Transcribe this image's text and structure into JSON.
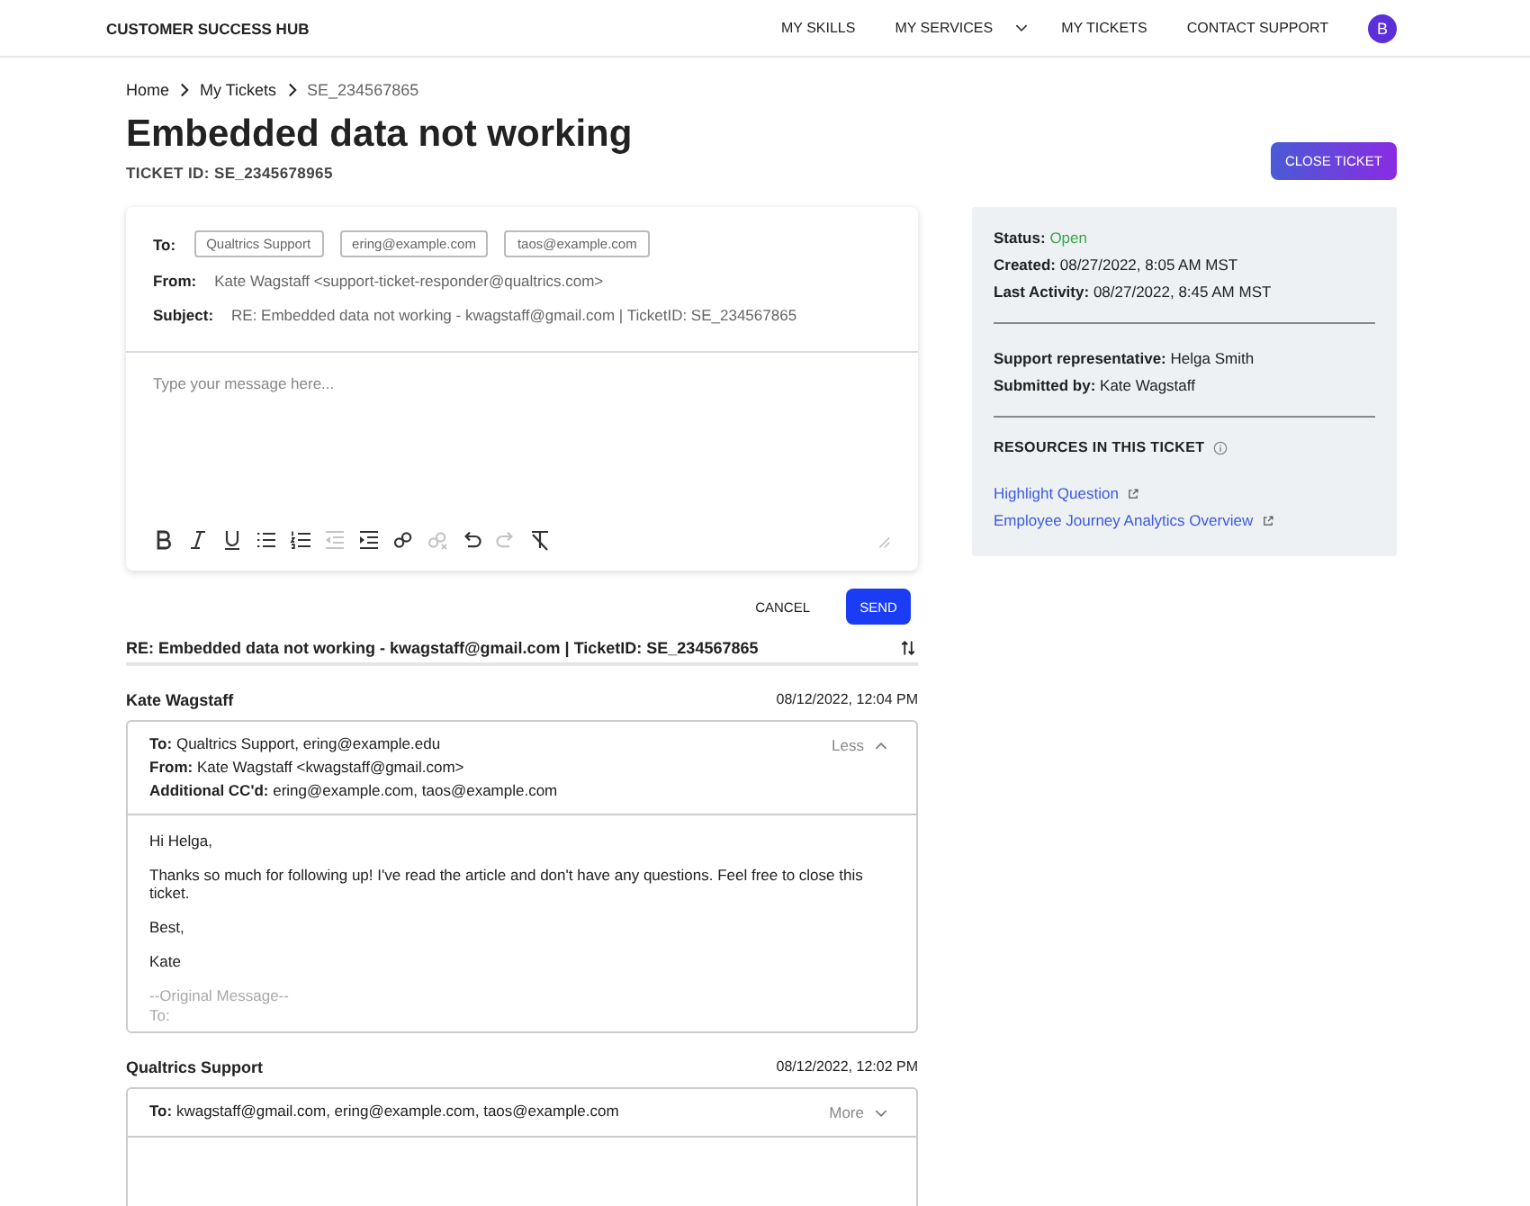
{
  "nav": {
    "brand": "CUSTOMER SUCCESS HUB",
    "items": [
      {
        "label": "MY SKILLS",
        "dropdown": false
      },
      {
        "label": "MY SERVICES",
        "dropdown": true
      },
      {
        "label": "MY TICKETS",
        "dropdown": false
      },
      {
        "label": "CONTACT SUPPORT",
        "dropdown": false
      }
    ],
    "avatar": "B"
  },
  "breadcrumb": [
    "Home",
    "My Tickets",
    "SE_234567865"
  ],
  "title": "Embedded data not working",
  "ticket_id": "TICKET ID: SE_2345678965",
  "close_button": "CLOSE TICKET",
  "composer": {
    "to_label": "To:",
    "to_chips": [
      "Qualtrics Support",
      "ering@example.com",
      "taos@example.com"
    ],
    "from_label": "From:",
    "from_value": "Kate Wagstaff <support-ticket-responder@qualtrics.com>",
    "subject_label": "Subject:",
    "subject_value": "RE: Embedded data not working - kwagstaff@gmail.com | TicketID: SE_234567865",
    "placeholder": "Type your message here...",
    "toolbar": [
      {
        "kind": "bold",
        "disabled": false
      },
      {
        "kind": "italic",
        "disabled": false
      },
      {
        "kind": "underline",
        "disabled": false
      },
      {
        "kind": "bullets",
        "disabled": false
      },
      {
        "kind": "numbers",
        "disabled": false
      },
      {
        "kind": "outdent",
        "disabled": true
      },
      {
        "kind": "indent",
        "disabled": false
      },
      {
        "kind": "link",
        "disabled": false
      },
      {
        "kind": "unlink",
        "disabled": true
      },
      {
        "kind": "undo",
        "disabled": false
      },
      {
        "kind": "redo",
        "disabled": true
      },
      {
        "kind": "clear",
        "disabled": false
      }
    ],
    "cancel": "CANCEL",
    "send": "SEND"
  },
  "thread": {
    "subject": "RE: Embedded data not working - kwagstaff@gmail.com | TicketID: SE_234567865",
    "messages": [
      {
        "sender": "Kate Wagstaff",
        "time": "08/12/2022, 12:04 PM",
        "expanded": true,
        "toggle": "Less",
        "fields": [
          {
            "label": "To:",
            "value": "Qualtrics Support, ering@example.edu"
          },
          {
            "label": "From:",
            "value": "Kate Wagstaff <kwagstaff@gmail.com>"
          },
          {
            "label": "Additional CC'd:",
            "value": "ering@example.com, taos@example.com"
          }
        ],
        "body": [
          "Hi Helga,",
          "Thanks so much for following up! I've read the article and don't have any questions. Feel free to close this ticket.",
          "Best,",
          "Kate"
        ],
        "quoted": [
          "--Original Message--",
          "To:"
        ]
      },
      {
        "sender": "Qualtrics Support",
        "time": "08/12/2022, 12:02 PM",
        "expanded": false,
        "toggle": "More",
        "fields": [
          {
            "label": "To:",
            "value": "kwagstaff@gmail.com, ering@example.com, taos@example.com"
          }
        ]
      }
    ]
  },
  "sidebar": {
    "details": [
      {
        "label": "Status:",
        "value": "Open",
        "kind": "status"
      },
      {
        "label": "Created:",
        "value": "08/27/2022, 8:05 AM MST",
        "kind": "text"
      },
      {
        "label": "Last Activity:",
        "value": "08/27/2022, 8:45 AM MST",
        "kind": "text"
      }
    ],
    "people": [
      {
        "label": "Support representative:",
        "value": "Helga Smith"
      },
      {
        "label": "Submitted by:",
        "value": "Kate Wagstaff"
      }
    ],
    "resources_title": "RESOURCES IN THIS TICKET",
    "resources": [
      "Highlight Question",
      "Employee Journey Analytics Overview"
    ]
  }
}
